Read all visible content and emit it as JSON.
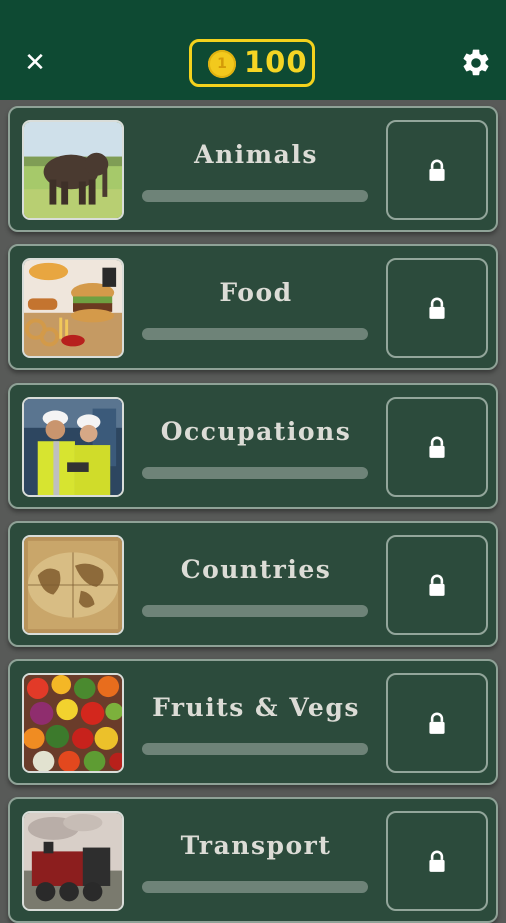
{
  "header": {
    "close_icon": "close-icon",
    "coins": {
      "amount": "100",
      "coin_symbol": "1"
    },
    "settings_icon": "gear-icon"
  },
  "categories": [
    {
      "title": "Animals",
      "image": "elephant-photo",
      "locked": true,
      "progress": 0
    },
    {
      "title": "Food",
      "image": "burger-and-fries-photo",
      "locked": true,
      "progress": 0
    },
    {
      "title": "Occupations",
      "image": "engineers-photo",
      "locked": true,
      "progress": 0
    },
    {
      "title": "Countries",
      "image": "old-world-map-photo",
      "locked": true,
      "progress": 0
    },
    {
      "title": "Fruits & Vegs",
      "image": "fruits-and-vegetables-photo",
      "locked": true,
      "progress": 0
    },
    {
      "title": "Transport",
      "image": "steam-train-photo",
      "locked": true,
      "progress": 0
    }
  ],
  "colors": {
    "header_bg": "#0e4a33",
    "card_bg": "#2c4b3c",
    "coin_yellow": "#f3d21d",
    "title_text": "#dcdcd6"
  }
}
